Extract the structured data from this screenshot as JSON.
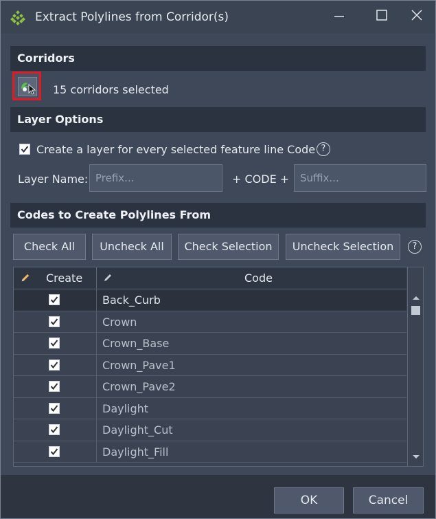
{
  "window": {
    "title": "Extract Polylines from Corridor(s)"
  },
  "corridors": {
    "header": "Corridors",
    "status": "15 corridors selected"
  },
  "layer_options": {
    "header": "Layer Options",
    "create_layer_label": "Create a layer for every selected feature line Code",
    "create_layer_checked": true,
    "layer_name_label": "Layer Name:",
    "prefix_placeholder": "Prefix...",
    "prefix_value": "",
    "plus_code_label": "+ CODE +",
    "suffix_placeholder": "Suffix...",
    "suffix_value": ""
  },
  "codes": {
    "header": "Codes to Create Polylines From",
    "buttons": {
      "check_all": "Check All",
      "uncheck_all": "Uncheck All",
      "check_selection": "Check Selection",
      "uncheck_selection": "Uncheck Selection"
    },
    "columns": {
      "create": "Create",
      "code": "Code"
    },
    "rows": [
      {
        "code": "Back_Curb",
        "checked": true
      },
      {
        "code": "Crown",
        "checked": true
      },
      {
        "code": "Crown_Base",
        "checked": true
      },
      {
        "code": "Crown_Pave1",
        "checked": true
      },
      {
        "code": "Crown_Pave2",
        "checked": true
      },
      {
        "code": "Daylight",
        "checked": true
      },
      {
        "code": "Daylight_Cut",
        "checked": true
      },
      {
        "code": "Daylight_Fill",
        "checked": true
      }
    ]
  },
  "footer": {
    "ok": "OK",
    "cancel": "Cancel"
  },
  "colors": {
    "accent_highlight": "#e01b24",
    "header_bg": "#2c3340",
    "panel_bg": "#3f4858"
  },
  "icons": [
    "app-icon",
    "minimize-icon",
    "maximize-icon",
    "close-icon",
    "select-corridor-icon",
    "help-icon",
    "pencil-icon",
    "scroll-up-icon",
    "scroll-down-icon",
    "checkmark-icon"
  ]
}
